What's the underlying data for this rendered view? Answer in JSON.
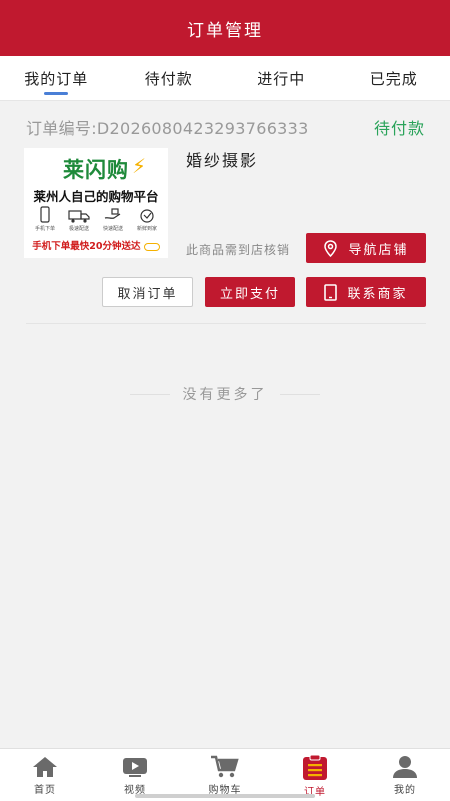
{
  "header": {
    "title": "订单管理"
  },
  "tabs": [
    {
      "label": "我的订单",
      "active": true
    },
    {
      "label": "待付款",
      "active": false
    },
    {
      "label": "进行中",
      "active": false
    },
    {
      "label": "已完成",
      "active": false
    }
  ],
  "order": {
    "number_text": "订单编号:D2026080423293766333",
    "status": "待付款",
    "product_name": "婚纱摄影",
    "verify_note": "此商品需到店核销",
    "image": {
      "brand": "莱闪购",
      "slogan": "莱州人自己的购物平台",
      "icon_labels": [
        "手机下单",
        "极速配送",
        "快速配送",
        "新鲜到家"
      ],
      "bottom_text": "手机下单最快20分钟送达"
    },
    "buttons": {
      "navigate": "导航店铺",
      "cancel": "取消订单",
      "pay": "立即支付",
      "contact": "联系商家"
    }
  },
  "footer_note": "没有更多了",
  "tabbar": [
    {
      "label": "首页",
      "icon": "home-icon"
    },
    {
      "label": "视频",
      "icon": "video-icon"
    },
    {
      "label": "购物车",
      "icon": "cart-icon"
    },
    {
      "label": "订单",
      "icon": "order-icon",
      "active": true
    },
    {
      "label": "我的",
      "icon": "user-icon"
    }
  ],
  "colors": {
    "brand_red": "#c0192f",
    "status_green": "#2aa35a",
    "tab_indicator": "#4a7fd6"
  }
}
